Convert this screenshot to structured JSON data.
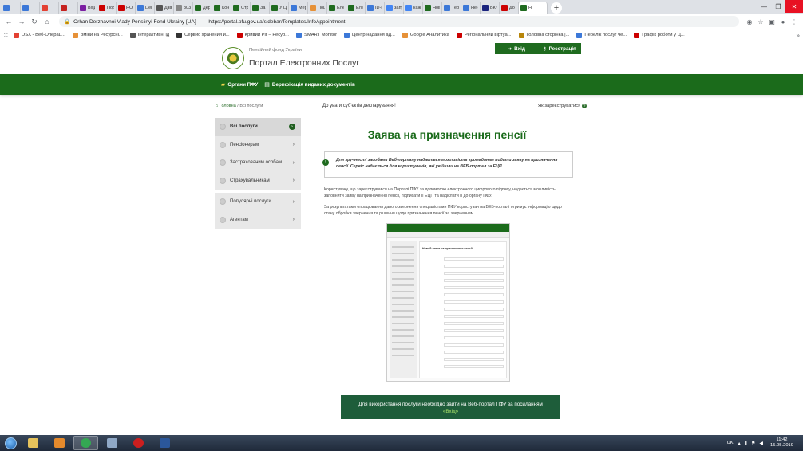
{
  "browser": {
    "tabs": [
      {
        "label": "",
        "color": "#3c78d8"
      },
      {
        "label": "",
        "color": "#3c78d8"
      },
      {
        "label": "",
        "color": "#e34133"
      },
      {
        "label": "",
        "color": "#c5221f"
      },
      {
        "label": "Вхід",
        "color": "#7b1fa2"
      },
      {
        "label": "Под",
        "color": "#cc0000"
      },
      {
        "label": "НОЮ",
        "color": "#cc0000"
      },
      {
        "label": "Цен",
        "color": "#3c78d8"
      },
      {
        "label": "Дзв",
        "color": "#555555"
      },
      {
        "label": "303",
        "color": "#888888"
      },
      {
        "label": "Дер",
        "color": "#1f6b1f"
      },
      {
        "label": "Кон",
        "color": "#1f6b1f"
      },
      {
        "label": "Стр",
        "color": "#1f6b1f"
      },
      {
        "label": "За 2",
        "color": "#1f6b1f"
      },
      {
        "label": "У Ц",
        "color": "#1f6b1f"
      },
      {
        "label": "Мер",
        "color": "#3c78d8"
      },
      {
        "label": "Пош",
        "color": "#e69138"
      },
      {
        "label": "Елек",
        "color": "#1f6b1f"
      },
      {
        "label": "Елек",
        "color": "#1f6b1f"
      },
      {
        "label": "ID-к",
        "color": "#3c78d8"
      },
      {
        "label": "запу",
        "color": "#4285f4"
      },
      {
        "label": "каж",
        "color": "#4285f4"
      },
      {
        "label": "Нові",
        "color": "#1f6b1f"
      },
      {
        "label": "Тер",
        "color": "#3c78d8"
      },
      {
        "label": "Не с",
        "color": "#3c78d8"
      },
      {
        "label": "ВКЛ",
        "color": "#1a237e"
      },
      {
        "label": "До П",
        "color": "#cc0000"
      },
      {
        "label": "Н",
        "color": "#1f6b1f",
        "active": true
      }
    ],
    "new_tab": "+",
    "window_controls": [
      "—",
      "❐",
      "✕"
    ],
    "address": {
      "secure_label": "Orhan Derzhavnoi Vlady Pensiinyi Fond Ukrainy [UA]",
      "url": "https://portal.pfu.gov.ua/sidebar/Templates/InfoAppointment"
    },
    "bookmarks": [
      {
        "label": "OSX - Веб-Операц...",
        "color": "#e34133"
      },
      {
        "label": "Зміни на Ресурсні...",
        "color": "#e69138"
      },
      {
        "label": "Інтерактивні ід",
        "color": "#555555"
      },
      {
        "label": "Сервис хранения и...",
        "color": "#333333"
      },
      {
        "label": "Кривий Ріг – Ресур...",
        "color": "#cc0000"
      },
      {
        "label": "SMART Monitor",
        "color": "#3c78d8"
      },
      {
        "label": "Центр надання ад...",
        "color": "#3c78d8"
      },
      {
        "label": "Google Аналитика",
        "color": "#e69138"
      },
      {
        "label": "Регіональний віртуа...",
        "color": "#cc0000"
      },
      {
        "label": "Головна сторінка |...",
        "color": "#b8860b"
      },
      {
        "label": "Перелік послуг че...",
        "color": "#3c78d8"
      },
      {
        "label": "Графік роботи у Ц...",
        "color": "#cc0000"
      }
    ]
  },
  "site": {
    "fund_name": "Пенсійний фонд України",
    "portal_name": "Портал Електронних Послуг",
    "auth": {
      "login": "Вхід",
      "register": "Реєстрація"
    },
    "main_nav": [
      "Органи ПФУ",
      "Верифікація виданих документів"
    ],
    "breadcrumb": {
      "home": "Головна",
      "separator": " / ",
      "current": "Всі послуги"
    },
    "disabled_link": "До уваги суб'єктів декларування!",
    "how_to_register": "Як зареєструватися",
    "sidebar_group1": [
      "Всі послуги",
      "Пенсіонерам",
      "Застрахованим особам",
      "Страхувальникам"
    ],
    "sidebar_group2": [
      "Популярні послуги",
      "Агентам"
    ],
    "page_title": "Заява на призначення пенсії",
    "notice": "Для зручності засобами Веб-порталу надається можливість громадянам подати заяву на призначення пенсії. Сервіс надається для користувачів, які увійшли на ВЕБ-портал за ЕЦП.",
    "para1": "Користувачу, що зареєструвався на Порталі ПФУ за допомогою електронного цифрового підпису, надається можливість заповнити заяву на призначення пенсії, підписати її ЕЦП та надіслати її до органу ПФУ.",
    "para2": "За результатами опрацювання даного звернення спеціалістами ПФУ користувач на ВЕБ-порталі отримує інформацію щодо стану обробки звернення та рішення щодо призначення пенсії за зверненням.",
    "example_form_title": "Новий запит на призначення пенсії",
    "cta_text": "Для використання послуги необхідно зайти на Веб-портал ПФУ за посиланням",
    "cta_link": "«Вхід»"
  },
  "taskbar": {
    "apps": [
      {
        "name": "explorer",
        "color": "#e6c35c"
      },
      {
        "name": "media",
        "color": "#e58a2c"
      },
      {
        "name": "chrome",
        "color": "#34a853",
        "active": true
      },
      {
        "name": "settings",
        "color": "#8fa8c6"
      },
      {
        "name": "opera",
        "color": "#cc1f1f"
      },
      {
        "name": "word",
        "color": "#2b579a"
      }
    ],
    "language": "UK",
    "time": "11:42",
    "date": "15.05.2019"
  },
  "colors": {
    "brand_green": "#1b6b1b",
    "cta_green": "#1e5d3a"
  }
}
